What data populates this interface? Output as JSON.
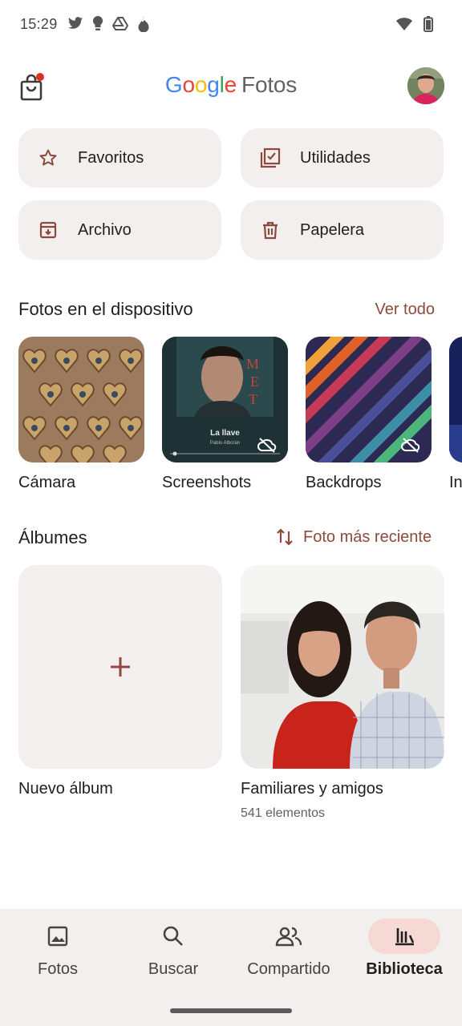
{
  "status_bar": {
    "time": "15:29",
    "left_icons": [
      "twitter-icon",
      "bulb-icon",
      "drive-icon",
      "fire-icon"
    ],
    "right_icons": [
      "wifi-icon",
      "battery-icon"
    ]
  },
  "header": {
    "logo_google": [
      "G",
      "o",
      "o",
      "g",
      "l",
      "e"
    ],
    "logo_product": "Fotos",
    "cart_badge": true
  },
  "quick_actions": [
    {
      "label": "Favoritos",
      "icon": "star-icon"
    },
    {
      "label": "Utilidades",
      "icon": "utilities-icon"
    },
    {
      "label": "Archivo",
      "icon": "archive-icon"
    },
    {
      "label": "Papelera",
      "icon": "trash-icon"
    }
  ],
  "device_section": {
    "title": "Fotos en el dispositivo",
    "link": "Ver todo",
    "folders": [
      {
        "label": "Cámara",
        "backed_up": true
      },
      {
        "label": "Screenshots",
        "backed_up": false,
        "art_title": "La llave",
        "art_artist": "Pablo Alborán"
      },
      {
        "label": "Backdrops",
        "backed_up": false
      },
      {
        "label": "In",
        "backed_up": true
      }
    ]
  },
  "albums_section": {
    "title": "Álbumes",
    "sort_label": "Foto más reciente",
    "albums": [
      {
        "title": "Nuevo álbum",
        "subtitle": ""
      },
      {
        "title": "Familiares y amigos",
        "subtitle": "541 elementos"
      }
    ]
  },
  "bottom_nav": {
    "items": [
      {
        "label": "Fotos",
        "icon": "photo-icon",
        "active": false
      },
      {
        "label": "Buscar",
        "icon": "search-icon",
        "active": false
      },
      {
        "label": "Compartido",
        "icon": "people-icon",
        "active": false
      },
      {
        "label": "Biblioteca",
        "icon": "library-icon",
        "active": true
      }
    ]
  },
  "colors": {
    "accent": "#8c4a3c",
    "surface": "#f3efee",
    "active_pill": "#f6d9d4"
  }
}
